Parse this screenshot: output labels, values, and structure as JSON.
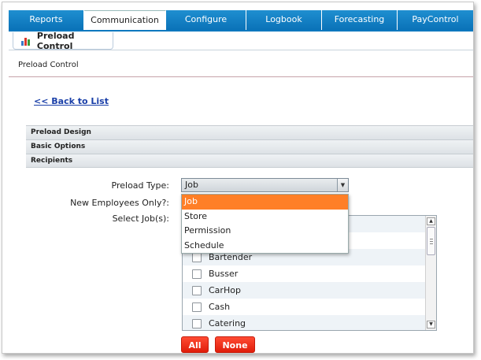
{
  "nav": {
    "tabs": [
      {
        "label": "Reports"
      },
      {
        "label": "Communication"
      },
      {
        "label": "Configure"
      },
      {
        "label": "Logbook"
      },
      {
        "label": "Forecasting"
      },
      {
        "label": "PayControl"
      }
    ],
    "active_tab": "Communication"
  },
  "subtab": {
    "label": "Preload Control"
  },
  "page": {
    "section_title": "Preload Control",
    "back_link": "<< Back to List"
  },
  "accordion": {
    "design": "Preload Design",
    "basic": "Basic Options",
    "recipients": "Recipients"
  },
  "form": {
    "preload_type_label": "Preload Type:",
    "preload_type_value": "Job",
    "new_employees_label": "New Employees Only?:",
    "select_jobs_label": "Select Job(s):"
  },
  "dropdown": {
    "options": [
      "Job",
      "Store",
      "Permission",
      "Schedule"
    ],
    "selected": "Job"
  },
  "jobs": [
    {
      "label": "Bartender",
      "checked": false
    },
    {
      "label": "Busser",
      "checked": false
    },
    {
      "label": "CarHop",
      "checked": false
    },
    {
      "label": "Cash",
      "checked": false
    },
    {
      "label": "Catering",
      "checked": false
    }
  ],
  "buttons": {
    "all": "All",
    "none": "None"
  },
  "colors": {
    "nav_blue": "#0a72b8",
    "menu_highlight": "#ff7f27",
    "button_red": "#e01d0a",
    "link_blue": "#1a3fa8"
  }
}
